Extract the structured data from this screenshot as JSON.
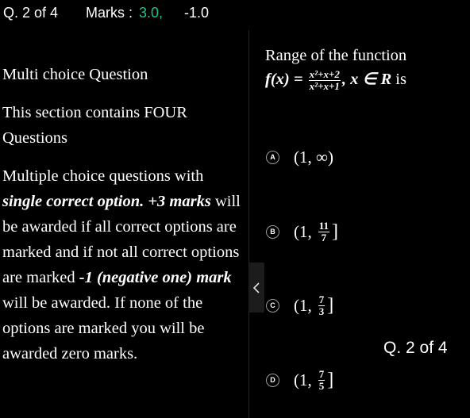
{
  "header": {
    "question_number": "Q. 2 of 4",
    "marks_label": "Marks :",
    "marks_positive": "3.0,",
    "marks_negative": "-1.0"
  },
  "instructions": {
    "type": "Multi choice Question",
    "section_info": "This section contains FOUR Questions",
    "body_start": "Multiple choice questions with",
    "bold1": "single correct option. +3 marks",
    "body_mid": "will be awarded if all correct options are marked and if not all correct options are marked",
    "bold2": "-1 (negative one) mark",
    "body_end": "will be awarded. If none of the options are marked you will be awarded zero marks."
  },
  "question": {
    "line1": "Range of the function",
    "func_name": "f(x) =",
    "numerator": "x²+x+2",
    "denominator": "x²+x+1",
    "comma": ",",
    "domain_expr": "x ∈ R",
    "suffix": "is"
  },
  "options": [
    {
      "letter": "A",
      "prefix": "(1, ∞)",
      "num": "",
      "den": "",
      "close": ""
    },
    {
      "letter": "B",
      "prefix": "(1,",
      "num": "11",
      "den": "7",
      "close": "]"
    },
    {
      "letter": "C",
      "prefix": "(1,",
      "num": "7",
      "den": "3",
      "close": "]"
    },
    {
      "letter": "D",
      "prefix": "(1,",
      "num": "7",
      "den": "5",
      "close": "]"
    }
  ],
  "footer": {
    "question_number": "Q. 2 of 4"
  },
  "icons": {
    "collapse": "chevron-left-icon"
  },
  "colors": {
    "background": "#000000",
    "positive_marks": "#1fc28b",
    "text": "#ffffff"
  }
}
